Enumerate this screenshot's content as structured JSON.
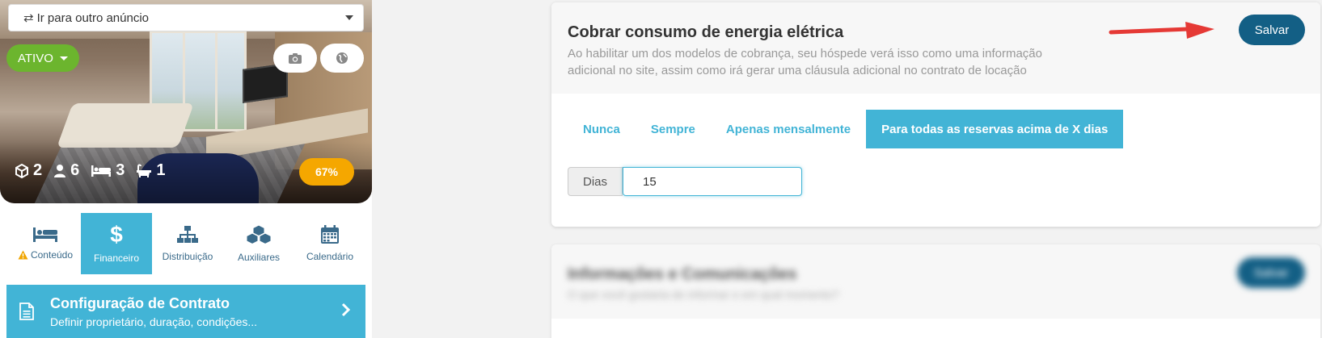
{
  "listing": {
    "goto_placeholder": "Ir para outro anúncio",
    "status": "ATIVO",
    "stats": {
      "rooms": "2",
      "guests": "6",
      "beds": "3",
      "baths": "1"
    },
    "completion": "67%"
  },
  "nav": [
    {
      "label": "Conteúdo",
      "icon": "bed-icon",
      "warning": true
    },
    {
      "label": "Financeiro",
      "icon": "dollar-icon",
      "active": true
    },
    {
      "label": "Distribuição",
      "icon": "sitemap-icon"
    },
    {
      "label": "Auxiliares",
      "icon": "cubes-icon"
    },
    {
      "label": "Calendário",
      "icon": "calendar-icon"
    }
  ],
  "contract_card": {
    "title": "Configuração de Contrato",
    "subtitle": "Definir proprietário, duração, condições..."
  },
  "energy": {
    "title": "Cobrar consumo de energia elétrica",
    "description": "Ao habilitar um dos modelos de cobrança, seu hóspede verá isso como uma informação adicional no site, assim como irá gerar uma cláusula adicional no contrato de locação",
    "save_label": "Salvar",
    "tabs": [
      "Nunca",
      "Sempre",
      "Apenas mensalmente",
      "Para todas as reservas acima de X dias"
    ],
    "active_tab": "Para todas as reservas acima de X dias",
    "days_label": "Dias",
    "days_value": "15"
  },
  "info_card": {
    "title": "Informações e Comunicações",
    "subtitle": "O que você gostaria de informar e em qual momento?",
    "save_label": "Salvar"
  },
  "colors": {
    "accent": "#42b4d6",
    "primary_dark": "#135f85",
    "status_green": "#6cb52e",
    "badge_orange": "#f5a700",
    "arrow_red": "#e53935"
  }
}
